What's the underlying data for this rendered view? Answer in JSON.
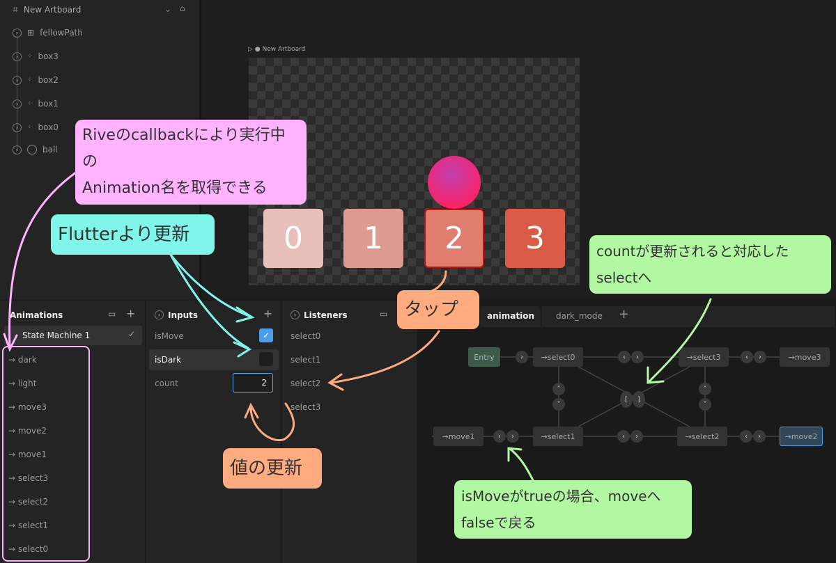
{
  "hierarchy": {
    "artboard": "New Artboard",
    "items": [
      "fellowPath",
      "box3",
      "box2",
      "box1",
      "box0",
      "ball"
    ]
  },
  "stage": {
    "artboard_label": "New Artboard",
    "boxes": [
      "0",
      "1",
      "2",
      "3"
    ],
    "box_colors": [
      "#e8c0b9",
      "#dc9b8e",
      "#e07d6e",
      "#d95a45"
    ]
  },
  "animations": {
    "title": "Animations",
    "state_machine": "State Machine 1",
    "items": [
      "dark",
      "light",
      "move3",
      "move2",
      "move1",
      "select3",
      "select2",
      "select1",
      "select0"
    ]
  },
  "inputs": {
    "title": "Inputs",
    "items": [
      {
        "name": "isMove",
        "type": "bool",
        "value": true
      },
      {
        "name": "isDark",
        "type": "bool",
        "value": false
      },
      {
        "name": "count",
        "type": "number",
        "value": "2"
      }
    ]
  },
  "listeners": {
    "title": "Listeners",
    "items": [
      "select0",
      "select1",
      "select2",
      "select3"
    ]
  },
  "graph": {
    "tabs": [
      "animation",
      "dark_mode"
    ],
    "active_tab": "animation",
    "entry": "Entry",
    "nodes": [
      "select0",
      "select3",
      "move3",
      "move1",
      "select1",
      "select2",
      "move2"
    ],
    "selected": "move2"
  },
  "notes": {
    "callback": [
      "Riveのcallbackにより実行中の",
      "Animation名を取得できる"
    ],
    "flutter": "Flutterより更新",
    "tap": "タップ",
    "count": [
      "countが更新されると対応した",
      "selectへ"
    ],
    "value": "値の更新",
    "ismove": [
      "isMoveがtrueの場合、moveへ",
      "falseで戻る"
    ]
  },
  "colors": {
    "pink": "#ffb3ff",
    "cyan": "#80f5ea",
    "orange": "#ffab80",
    "green": "#b2f7a2"
  }
}
